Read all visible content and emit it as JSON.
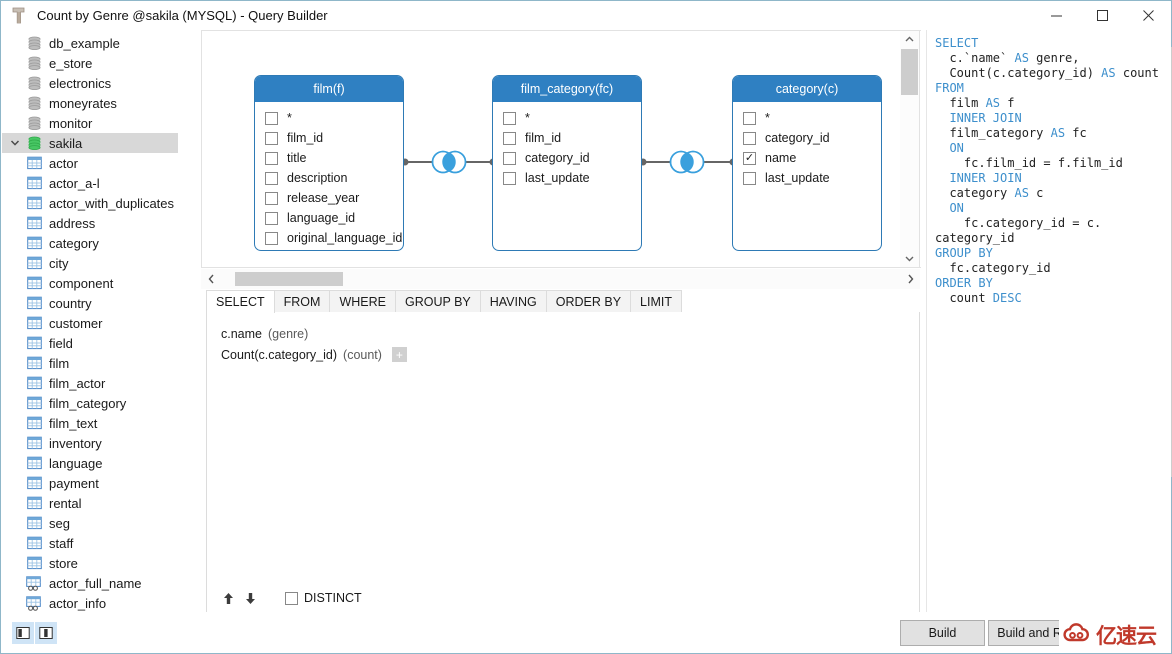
{
  "window": {
    "title": "Count by Genre @sakila (MYSQL) - Query Builder",
    "app_icon": "hammer-icon",
    "minimize_label": "─",
    "maximize_label": "□",
    "close_label": "✕"
  },
  "sidebar": {
    "databases": [
      {
        "label": "db_example",
        "icon": "database-icon",
        "selected": false,
        "expanded": false
      },
      {
        "label": "e_store",
        "icon": "database-icon",
        "selected": false,
        "expanded": false
      },
      {
        "label": "electronics",
        "icon": "database-icon",
        "selected": false,
        "expanded": false
      },
      {
        "label": "moneyrates",
        "icon": "database-icon",
        "selected": false,
        "expanded": false
      },
      {
        "label": "monitor",
        "icon": "database-icon",
        "selected": false,
        "expanded": false
      },
      {
        "label": "sakila",
        "icon": "database-icon-active",
        "selected": true,
        "expanded": true
      }
    ],
    "tables": [
      {
        "label": "actor",
        "icon": "table-icon"
      },
      {
        "label": "actor_a-l",
        "icon": "table-icon"
      },
      {
        "label": "actor_with_duplicates",
        "icon": "table-icon"
      },
      {
        "label": "address",
        "icon": "table-icon"
      },
      {
        "label": "category",
        "icon": "table-icon"
      },
      {
        "label": "city",
        "icon": "table-icon"
      },
      {
        "label": "component",
        "icon": "table-icon"
      },
      {
        "label": "country",
        "icon": "table-icon"
      },
      {
        "label": "customer",
        "icon": "table-icon"
      },
      {
        "label": "field",
        "icon": "table-icon"
      },
      {
        "label": "film",
        "icon": "table-icon"
      },
      {
        "label": "film_actor",
        "icon": "table-icon"
      },
      {
        "label": "film_category",
        "icon": "table-icon"
      },
      {
        "label": "film_text",
        "icon": "table-icon"
      },
      {
        "label": "inventory",
        "icon": "table-icon"
      },
      {
        "label": "language",
        "icon": "table-icon"
      },
      {
        "label": "payment",
        "icon": "table-icon"
      },
      {
        "label": "rental",
        "icon": "table-icon"
      },
      {
        "label": "seg",
        "icon": "table-icon"
      },
      {
        "label": "staff",
        "icon": "table-icon"
      },
      {
        "label": "store",
        "icon": "table-icon"
      },
      {
        "label": "actor_full_name",
        "icon": "view-icon"
      },
      {
        "label": "actor_info",
        "icon": "view-icon"
      }
    ]
  },
  "diagram": {
    "tables": [
      {
        "title": "film(f)",
        "fields": [
          {
            "name": "*",
            "checked": false
          },
          {
            "name": "film_id",
            "checked": false
          },
          {
            "name": "title",
            "checked": false
          },
          {
            "name": "description",
            "checked": false
          },
          {
            "name": "release_year",
            "checked": false
          },
          {
            "name": "language_id",
            "checked": false
          },
          {
            "name": "original_language_id",
            "checked": false
          }
        ]
      },
      {
        "title": "film_category(fc)",
        "fields": [
          {
            "name": "*",
            "checked": false
          },
          {
            "name": "film_id",
            "checked": false
          },
          {
            "name": "category_id",
            "checked": false
          },
          {
            "name": "last_update",
            "checked": false
          }
        ]
      },
      {
        "title": "category(c)",
        "fields": [
          {
            "name": "*",
            "checked": false
          },
          {
            "name": "category_id",
            "checked": false
          },
          {
            "name": "name",
            "checked": true
          },
          {
            "name": "last_update",
            "checked": false
          }
        ]
      }
    ],
    "joins": [
      {
        "icon": "inner-join-icon",
        "from": "film(f)",
        "to": "film_category(fc)"
      },
      {
        "icon": "inner-join-icon",
        "from": "film_category(fc)",
        "to": "category(c)"
      }
    ],
    "scroll_left_icon": "chevron-left-icon",
    "scroll_right_icon": "chevron-right-icon",
    "scroll_up_icon": "chevron-up-icon",
    "scroll_down_icon": "chevron-down-icon"
  },
  "clause_panel": {
    "tabs": [
      {
        "label": "SELECT",
        "active": true
      },
      {
        "label": "FROM",
        "active": false
      },
      {
        "label": "WHERE",
        "active": false
      },
      {
        "label": "GROUP BY",
        "active": false
      },
      {
        "label": "HAVING",
        "active": false
      },
      {
        "label": "ORDER BY",
        "active": false
      },
      {
        "label": "LIMIT",
        "active": false
      }
    ],
    "expressions": [
      {
        "expr": "c.name",
        "alias": "(genre)"
      },
      {
        "expr": "Count(c.category_id)",
        "alias": "(count)"
      }
    ],
    "add_button_label": "+",
    "move_up_icon": "arrow-up-icon",
    "move_down_icon": "arrow-down-icon",
    "distinct_label": "DISTINCT",
    "distinct_checked": false
  },
  "sql": {
    "lines": [
      [
        {
          "t": "SELECT",
          "kw": true
        }
      ],
      [
        {
          "t": "  c.`name` ",
          "kw": false
        },
        {
          "t": "AS",
          "kw": true
        },
        {
          "t": " genre,",
          "kw": false
        }
      ],
      [
        {
          "t": "  Count(c.category_id) ",
          "kw": false
        },
        {
          "t": "AS",
          "kw": true
        },
        {
          "t": " count",
          "kw": false
        }
      ],
      [
        {
          "t": "FROM",
          "kw": true
        }
      ],
      [
        {
          "t": "  film ",
          "kw": false
        },
        {
          "t": "AS",
          "kw": true
        },
        {
          "t": " f",
          "kw": false
        }
      ],
      [
        {
          "t": "  ",
          "kw": false
        },
        {
          "t": "INNER JOIN",
          "kw": true
        }
      ],
      [
        {
          "t": "  film_category ",
          "kw": false
        },
        {
          "t": "AS",
          "kw": true
        },
        {
          "t": " fc",
          "kw": false
        }
      ],
      [
        {
          "t": "  ",
          "kw": false
        },
        {
          "t": "ON",
          "kw": true
        }
      ],
      [
        {
          "t": "    fc.film_id = f.film_id",
          "kw": false
        }
      ],
      [
        {
          "t": "  ",
          "kw": false
        },
        {
          "t": "INNER JOIN",
          "kw": true
        }
      ],
      [
        {
          "t": "  category ",
          "kw": false
        },
        {
          "t": "AS",
          "kw": true
        },
        {
          "t": " c",
          "kw": false
        }
      ],
      [
        {
          "t": "  ",
          "kw": false
        },
        {
          "t": "ON",
          "kw": true
        }
      ],
      [
        {
          "t": "    fc.category_id = c.",
          "kw": false
        }
      ],
      [
        {
          "t": "category_id",
          "kw": false
        }
      ],
      [
        {
          "t": "GROUP BY",
          "kw": true
        }
      ],
      [
        {
          "t": "  fc.category_id",
          "kw": false
        }
      ],
      [
        {
          "t": "ORDER BY",
          "kw": true
        }
      ],
      [
        {
          "t": "  count ",
          "kw": false
        },
        {
          "t": "DESC",
          "kw": true
        }
      ]
    ]
  },
  "footer": {
    "toggle_left_icon": "panel-left-icon",
    "toggle_right_icon": "panel-right-icon",
    "build_label": "Build",
    "build_and_run_label": "Build and Run",
    "third_button_label": ""
  },
  "watermark": {
    "text": "亿速云",
    "logo_icon": "cloud-logo-icon"
  },
  "colors": {
    "accent": "#2f80c2",
    "table_header": "#2f80c2",
    "keyword": "#3d8fcc",
    "selection": "#d8d8d8",
    "button_face": "#e1e1e1"
  }
}
